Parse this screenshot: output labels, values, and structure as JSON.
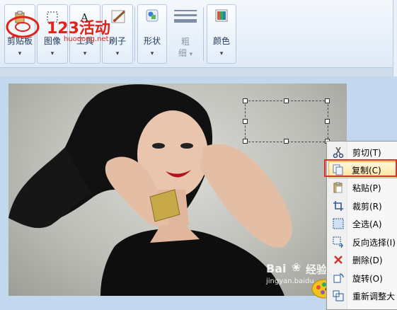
{
  "ribbon": {
    "clipboard_label": "剪贴板",
    "image_label": "图像",
    "tools_label": "工具",
    "brushes_label": "刷子",
    "shapes_label": "形状",
    "size_label_1": "粗",
    "size_label_2": "细",
    "colors_label": "颜色",
    "dropdown_glyph": "▾"
  },
  "watermark": {
    "brand_text": "123活动",
    "domain_text": "huodong.net"
  },
  "context_menu": {
    "items": [
      {
        "label": "剪切(T)",
        "icon": "scissors-icon"
      },
      {
        "label": "复制(C)",
        "icon": "copy-icon",
        "highlighted": true
      },
      {
        "label": "粘贴(P)",
        "icon": "paste-icon"
      },
      {
        "label": "裁剪(R)",
        "icon": "crop-icon"
      },
      {
        "label": "全选(A)",
        "icon": "select-all-icon"
      },
      {
        "label": "反向选择(I)",
        "icon": "invert-selection-icon"
      },
      {
        "label": "删除(D)",
        "icon": "delete-icon"
      },
      {
        "label": "旋转(O)",
        "icon": "rotate-icon"
      },
      {
        "label": "重新调整大",
        "icon": "resize-icon"
      }
    ]
  },
  "baidu_watermark": {
    "text": "Bai",
    "text2": "经验",
    "url": "jingyan.baidu"
  },
  "colors": {
    "highlight_border": "#d8332a",
    "ribbon_bg": "#dce8f6",
    "canvas_bg": "#c3d7ee",
    "logo_red": "#e2231a"
  }
}
